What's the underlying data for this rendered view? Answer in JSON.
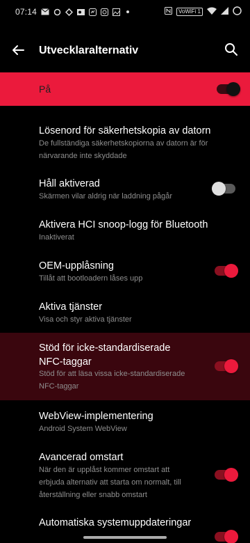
{
  "status": {
    "time": "07:14",
    "volte": "VoWiFi 1"
  },
  "appbar": {
    "title": "Utvecklaralternativ"
  },
  "master": {
    "label": "På",
    "on": true
  },
  "items": [
    {
      "title": "Lösenord för säkerhetskopia av datorn",
      "subtitle_lines": [
        "De fullständiga säkerhetskopiorna av datorn är för",
        "närvarande inte skyddade"
      ]
    },
    {
      "title": "Håll aktiverad",
      "subtitle_lines": [
        "Skärmen vilar aldrig när laddning pågår"
      ],
      "toggle": "off"
    },
    {
      "title": "Aktivera HCI snoop-logg för Bluetooth",
      "subtitle_lines": [
        "Inaktiverat"
      ]
    },
    {
      "title": "OEM-upplåsning",
      "subtitle_lines": [
        "Tillåt att bootloadern låses upp"
      ],
      "toggle": "on"
    },
    {
      "title": "Aktiva tjänster",
      "subtitle_lines": [
        "Visa och styr aktiva tjänster"
      ]
    },
    {
      "title_lines": [
        "Stöd för icke-standardiserade",
        "NFC-taggar"
      ],
      "subtitle_lines": [
        "Stöd för att läsa vissa icke-standardiserade",
        "NFC-taggar"
      ],
      "toggle": "on",
      "highlighted": true
    },
    {
      "title": "WebView-implementering",
      "subtitle_lines": [
        "Android System WebView"
      ]
    },
    {
      "title": "Avancerad omstart",
      "subtitle_lines": [
        "När den är upplåst kommer omstart att",
        "erbjuda alternativ att starta om normalt, till",
        "återställning eller snabb omstart"
      ],
      "toggle": "on"
    },
    {
      "title": "Automatiska systemuppdateringar",
      "toggle": "on"
    }
  ],
  "colors": {
    "accent": "#eb1a3c",
    "highlight_bg": "#3a060e",
    "subtitle": "#8e8e8e"
  }
}
